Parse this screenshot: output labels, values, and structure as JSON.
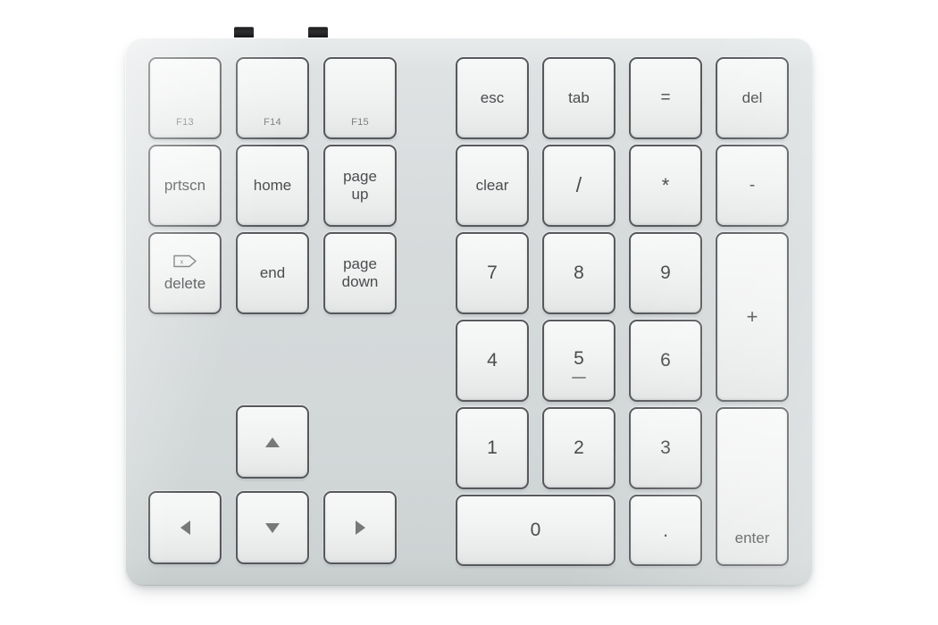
{
  "device": {
    "name": "aluminum-numeric-keypad",
    "body_color": "#d5d9da",
    "key_face_color": "#f1f2f2",
    "key_border_color": "#56585b",
    "label_color": "#4a4c4e",
    "glyph_color": "#767879"
  },
  "connectors": [
    {
      "name": "top-nub-left"
    },
    {
      "name": "top-nub-right"
    }
  ],
  "left_block": {
    "function_row": [
      {
        "name": "key-f13",
        "label": "F13"
      },
      {
        "name": "key-f14",
        "label": "F14"
      },
      {
        "name": "key-f15",
        "label": "F15"
      }
    ],
    "nav_row_1": [
      {
        "name": "key-prtscn",
        "label": "prtscn"
      },
      {
        "name": "key-home",
        "label": "home"
      },
      {
        "name": "key-page-up",
        "label": "page\nup"
      }
    ],
    "nav_row_2": [
      {
        "name": "key-delete",
        "label": "delete",
        "icon": "forward-delete-icon"
      },
      {
        "name": "key-end",
        "label": "end"
      },
      {
        "name": "key-page-down",
        "label": "page\ndown"
      }
    ],
    "arrows": [
      {
        "name": "key-arrow-up",
        "icon": "arrow-up-icon",
        "label": "▲"
      },
      {
        "name": "key-arrow-left",
        "icon": "arrow-left-icon",
        "label": "◀"
      },
      {
        "name": "key-arrow-down",
        "icon": "arrow-down-icon",
        "label": "▼"
      },
      {
        "name": "key-arrow-right",
        "icon": "arrow-right-icon",
        "label": "▶"
      }
    ]
  },
  "keypad": {
    "row_1": [
      {
        "name": "key-esc",
        "label": "esc"
      },
      {
        "name": "key-tab",
        "label": "tab"
      },
      {
        "name": "key-equals",
        "label": "="
      },
      {
        "name": "key-del",
        "label": "del"
      }
    ],
    "row_2": [
      {
        "name": "key-clear",
        "label": "clear"
      },
      {
        "name": "key-divide",
        "label": "/"
      },
      {
        "name": "key-multiply",
        "label": "*"
      },
      {
        "name": "key-minus",
        "label": "-"
      }
    ],
    "row_3": [
      {
        "name": "key-7",
        "label": "7"
      },
      {
        "name": "key-8",
        "label": "8"
      },
      {
        "name": "key-9",
        "label": "9"
      }
    ],
    "row_4": [
      {
        "name": "key-4",
        "label": "4"
      },
      {
        "name": "key-5",
        "label": "5",
        "homing_bar": true
      },
      {
        "name": "key-6",
        "label": "6"
      }
    ],
    "row_5": [
      {
        "name": "key-1",
        "label": "1"
      },
      {
        "name": "key-2",
        "label": "2"
      },
      {
        "name": "key-3",
        "label": "3"
      }
    ],
    "row_6": [
      {
        "name": "key-0",
        "label": "0",
        "wide": true
      },
      {
        "name": "key-period",
        "label": "."
      }
    ],
    "tall_keys": [
      {
        "name": "key-plus",
        "label": "+"
      },
      {
        "name": "key-enter",
        "label": "enter"
      }
    ]
  }
}
